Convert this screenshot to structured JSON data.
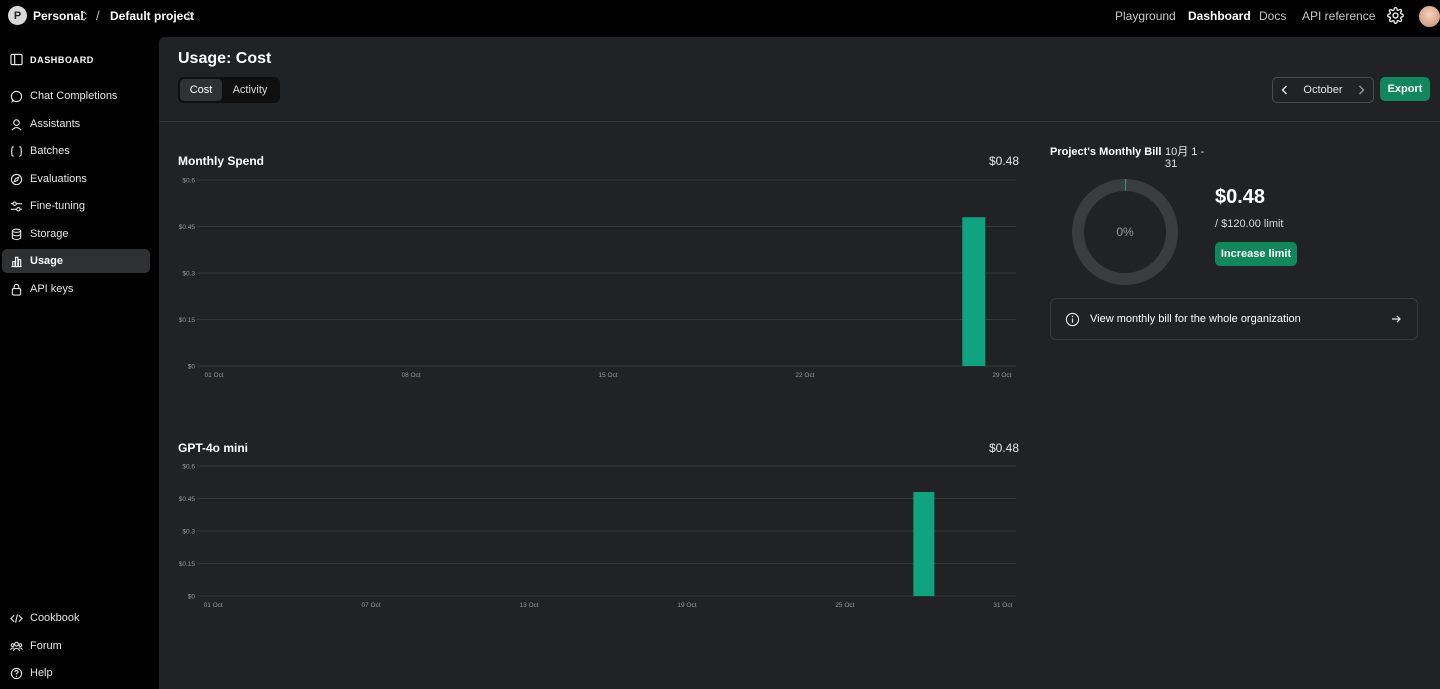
{
  "topbar": {
    "org_initial": "P",
    "org_name": "Personal",
    "separator": "/",
    "project_name": "Default project",
    "links": [
      "Playground",
      "Dashboard",
      "Docs",
      "API reference"
    ],
    "active_link": "Dashboard"
  },
  "sidebar": {
    "header": "DASHBOARD",
    "items": [
      {
        "label": "Chat Completions",
        "icon": "chat-icon"
      },
      {
        "label": "Assistants",
        "icon": "assistant-icon"
      },
      {
        "label": "Batches",
        "icon": "batches-icon"
      },
      {
        "label": "Evaluations",
        "icon": "compass-icon"
      },
      {
        "label": "Fine-tuning",
        "icon": "sliders-icon"
      },
      {
        "label": "Storage",
        "icon": "database-icon"
      },
      {
        "label": "Usage",
        "icon": "bar-chart-icon",
        "active": true
      },
      {
        "label": "API keys",
        "icon": "lock-icon"
      }
    ],
    "footer_items": [
      {
        "label": "Cookbook",
        "icon": "code-icon"
      },
      {
        "label": "Forum",
        "icon": "people-icon"
      },
      {
        "label": "Help",
        "icon": "help-icon"
      }
    ]
  },
  "main": {
    "title": "Usage: Cost",
    "tabs": [
      "Cost",
      "Activity"
    ],
    "active_tab": "Cost",
    "month": "October",
    "export_label": "Export"
  },
  "bill": {
    "title": "Project's Monthly Bill",
    "range_line1": "10月 1 -",
    "range_line2": "31",
    "percent": "0%",
    "percent_value": 0.004,
    "amount": "$0.48",
    "limit": "/ $120.00 limit",
    "increase_label": "Increase limit",
    "org_bill_text": "View monthly bill for the whole organization"
  },
  "colors": {
    "accent": "#11875d",
    "bar": "#10a37f",
    "panel": "#212223",
    "background": "#000000"
  },
  "chart_data": [
    {
      "type": "bar",
      "title": "Monthly Spend",
      "total": "$0.48",
      "x": [
        "01 Oct",
        "02 Oct",
        "03 Oct",
        "04 Oct",
        "05 Oct",
        "06 Oct",
        "07 Oct",
        "08 Oct",
        "09 Oct",
        "10 Oct",
        "11 Oct",
        "12 Oct",
        "13 Oct",
        "14 Oct",
        "15 Oct",
        "16 Oct",
        "17 Oct",
        "18 Oct",
        "19 Oct",
        "20 Oct",
        "21 Oct",
        "22 Oct",
        "23 Oct",
        "24 Oct",
        "25 Oct",
        "26 Oct",
        "27 Oct",
        "28 Oct",
        "29 Oct"
      ],
      "values": [
        0,
        0,
        0,
        0,
        0,
        0,
        0,
        0,
        0,
        0,
        0,
        0,
        0,
        0,
        0,
        0,
        0,
        0,
        0,
        0,
        0,
        0,
        0,
        0,
        0,
        0,
        0,
        0.48,
        0
      ],
      "x_ticks": [
        "01 Oct",
        "08 Oct",
        "15 Oct",
        "22 Oct",
        "29 Oct"
      ],
      "y_ticks": [
        "$0",
        "$0.15",
        "$0.3",
        "$0.45",
        "$0.6"
      ],
      "ylim": [
        0,
        0.6
      ],
      "grid": true
    },
    {
      "type": "bar",
      "title": "GPT-4o mini",
      "total": "$0.48",
      "x": [
        "01 Oct",
        "02 Oct",
        "03 Oct",
        "04 Oct",
        "05 Oct",
        "06 Oct",
        "07 Oct",
        "08 Oct",
        "09 Oct",
        "10 Oct",
        "11 Oct",
        "12 Oct",
        "13 Oct",
        "14 Oct",
        "15 Oct",
        "16 Oct",
        "17 Oct",
        "18 Oct",
        "19 Oct",
        "20 Oct",
        "21 Oct",
        "22 Oct",
        "23 Oct",
        "24 Oct",
        "25 Oct",
        "26 Oct",
        "27 Oct",
        "28 Oct",
        "29 Oct",
        "30 Oct",
        "31 Oct"
      ],
      "values": [
        0,
        0,
        0,
        0,
        0,
        0,
        0,
        0,
        0,
        0,
        0,
        0,
        0,
        0,
        0,
        0,
        0,
        0,
        0,
        0,
        0,
        0,
        0,
        0,
        0,
        0,
        0,
        0.48,
        0,
        0,
        0
      ],
      "x_ticks": [
        "01 Oct",
        "07 Oct",
        "13 Oct",
        "19 Oct",
        "25 Oct",
        "31 Oct"
      ],
      "y_ticks": [
        "$0",
        "$0.15",
        "$0.3",
        "$0.45",
        "$0.6"
      ],
      "ylim": [
        0,
        0.6
      ],
      "grid": true
    }
  ]
}
